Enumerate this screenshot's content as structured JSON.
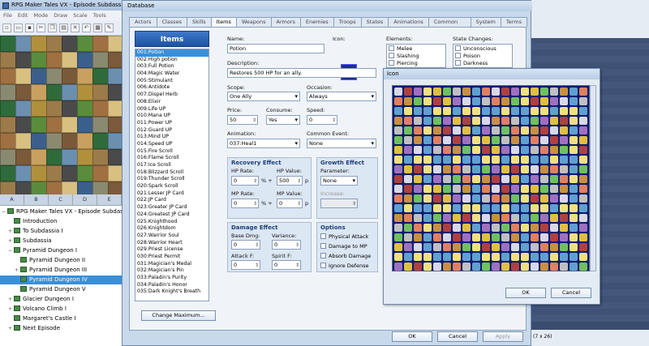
{
  "editor": {
    "title": "RPG Maker Tales VX - Episode Subdassia",
    "menu": [
      "File",
      "Edit",
      "Mode",
      "Draw",
      "Scale",
      "Tools"
    ],
    "tile_tabs": [
      "A",
      "B",
      "C",
      "D",
      "E"
    ],
    "map_tree": [
      {
        "label": "RPG Maker Tales VX - Episode Subdas",
        "indent": 0,
        "expander": "−",
        "selected": false
      },
      {
        "label": "Introduction",
        "indent": 1,
        "expander": "",
        "selected": false
      },
      {
        "label": "To Subdassia I",
        "indent": 1,
        "expander": "+",
        "selected": false
      },
      {
        "label": "Subdassia",
        "indent": 1,
        "expander": "+",
        "selected": false
      },
      {
        "label": "Pyramid Dungeon I",
        "indent": 1,
        "expander": "−",
        "selected": false
      },
      {
        "label": "Pyramid Dungeon II",
        "indent": 2,
        "expander": "",
        "selected": false
      },
      {
        "label": "Pyramid Dungeon III",
        "indent": 2,
        "expander": "+",
        "selected": false
      },
      {
        "label": "Pyramid Dungeon IV",
        "indent": 2,
        "expander": "",
        "selected": true
      },
      {
        "label": "Pyramid Dungeon V",
        "indent": 2,
        "expander": "",
        "selected": false
      },
      {
        "label": "Glacier Dungeon I",
        "indent": 1,
        "expander": "+",
        "selected": false
      },
      {
        "label": "Volcano Climb I",
        "indent": 1,
        "expander": "+",
        "selected": false
      },
      {
        "label": "Margaret's Castle I",
        "indent": 1,
        "expander": "",
        "selected": false
      },
      {
        "label": "Next Episode",
        "indent": 1,
        "expander": "+",
        "selected": false
      }
    ]
  },
  "database": {
    "title": "Database",
    "tabs": [
      "Actors",
      "Classes",
      "Skills",
      "Items",
      "Weapons",
      "Armors",
      "Enemies",
      "Troops",
      "States",
      "Animations",
      "Common Events",
      "System",
      "Terms"
    ],
    "active_tab": "Items",
    "list_header": "Items",
    "items": [
      "001:Potion",
      "002:High potion",
      "003:Full Potion",
      "004:Magic Water",
      "005:Stimulant",
      "006:Antidote",
      "007:Dispel Herb",
      "008:Elixir",
      "009:Life UP",
      "010:Mana UP",
      "011:Power UP",
      "012:Guard UP",
      "013:Mind UP",
      "014:Speed UP",
      "015:Fire Scroll",
      "016:Flame Scroll",
      "017:Ice Scroll",
      "018:Blizzard Scroll",
      "019:Thunder Scroll",
      "020:Spark Scroll",
      "021:Lesser JP Card",
      "022:JP Card",
      "023:Greater JP Card",
      "024:Greatest JP Card",
      "025:Knighthood",
      "026:Knightdom",
      "027:Warrior Soul",
      "028:Warrior Heart",
      "029:Priest License",
      "030:Priest Permit",
      "031:Magician's Medal",
      "032:Magician's Pin",
      "033:Paladin's Purity",
      "034:Paladin's Honor",
      "035:Dark Knight's Breath"
    ],
    "selected_item": "001:Potion",
    "change_max_label": "Change Maximum...",
    "labels": {
      "name": "Name:",
      "icon": "Icon:",
      "description": "Description:",
      "scope": "Scope:",
      "occasion": "Occasion:",
      "price": "Price:",
      "consume": "Consume:",
      "speed": "Speed:",
      "animation": "Animation:",
      "common_event": "Common Event:",
      "elements": "Elements:",
      "state_changes": "State Changes:"
    },
    "values": {
      "name": "Potion",
      "description": "Restores 500 HP for an ally.",
      "scope": "One Ally",
      "occasion": "Always",
      "price": "50",
      "consume": "Yes",
      "speed": "0",
      "animation": "037:Heal1",
      "common_event": "None"
    },
    "elements": [
      "Melee",
      "Slashing",
      "Piercing"
    ],
    "state_changes": [
      "Unconscious",
      "Poison",
      "Darkness"
    ],
    "recovery": {
      "title": "Recovery Effect",
      "hp_rate_label": "HP Rate:",
      "hp_rate": "0",
      "hp_value_label": "HP Value:",
      "hp_value": "500",
      "mp_rate_label": "MP Rate:",
      "mp_rate": "0",
      "mp_value_label": "MP Value:",
      "mp_value": "0",
      "pct": "% +",
      "p": "p"
    },
    "growth": {
      "title": "Growth Effect",
      "parameter_label": "Parameter:",
      "parameter": "None",
      "increase_label": "Increase:"
    },
    "damage": {
      "title": "Damage Effect",
      "base_dmg_label": "Base Dmg:",
      "base_dmg": "0",
      "variance_label": "Variance:",
      "variance": "0",
      "atk_f_label": "Attack F:",
      "atk_f": "0",
      "spi_f_label": "Spirit F:",
      "spi_f": "0"
    },
    "options": {
      "title": "Options",
      "items": [
        "Physical Attack",
        "Damage to MP",
        "Absorb Damage",
        "Ignore Defense"
      ]
    },
    "buttons": {
      "ok": "OK",
      "cancel": "Cancel",
      "apply": "Apply"
    }
  },
  "icon_dialog": {
    "title": "Icon",
    "ok": "OK",
    "cancel": "Cancel"
  },
  "statusbar": {
    "text": "(7 x 26)"
  }
}
